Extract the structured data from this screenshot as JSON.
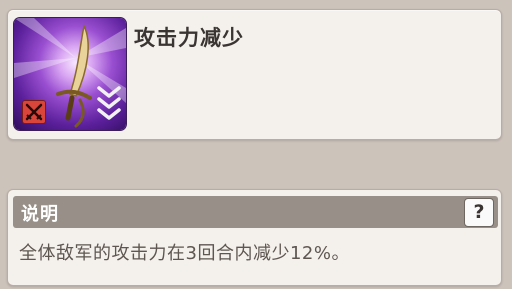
{
  "skill": {
    "name": "攻击力减少",
    "icon": "sword-icon",
    "badge_icon": "broken-swords-icon",
    "arrows_icon": "triple-chevron-down-icon"
  },
  "description": {
    "title": "说明",
    "help_label": "?",
    "text": "全体敌军的攻击力在3回合内减少12%。"
  },
  "colors": {
    "background": "#ccc3bb",
    "panel": "#f4f0ec",
    "header": "#978f88",
    "icon_purple": "#9a4fd1",
    "debuff_red": "#d9453a"
  }
}
